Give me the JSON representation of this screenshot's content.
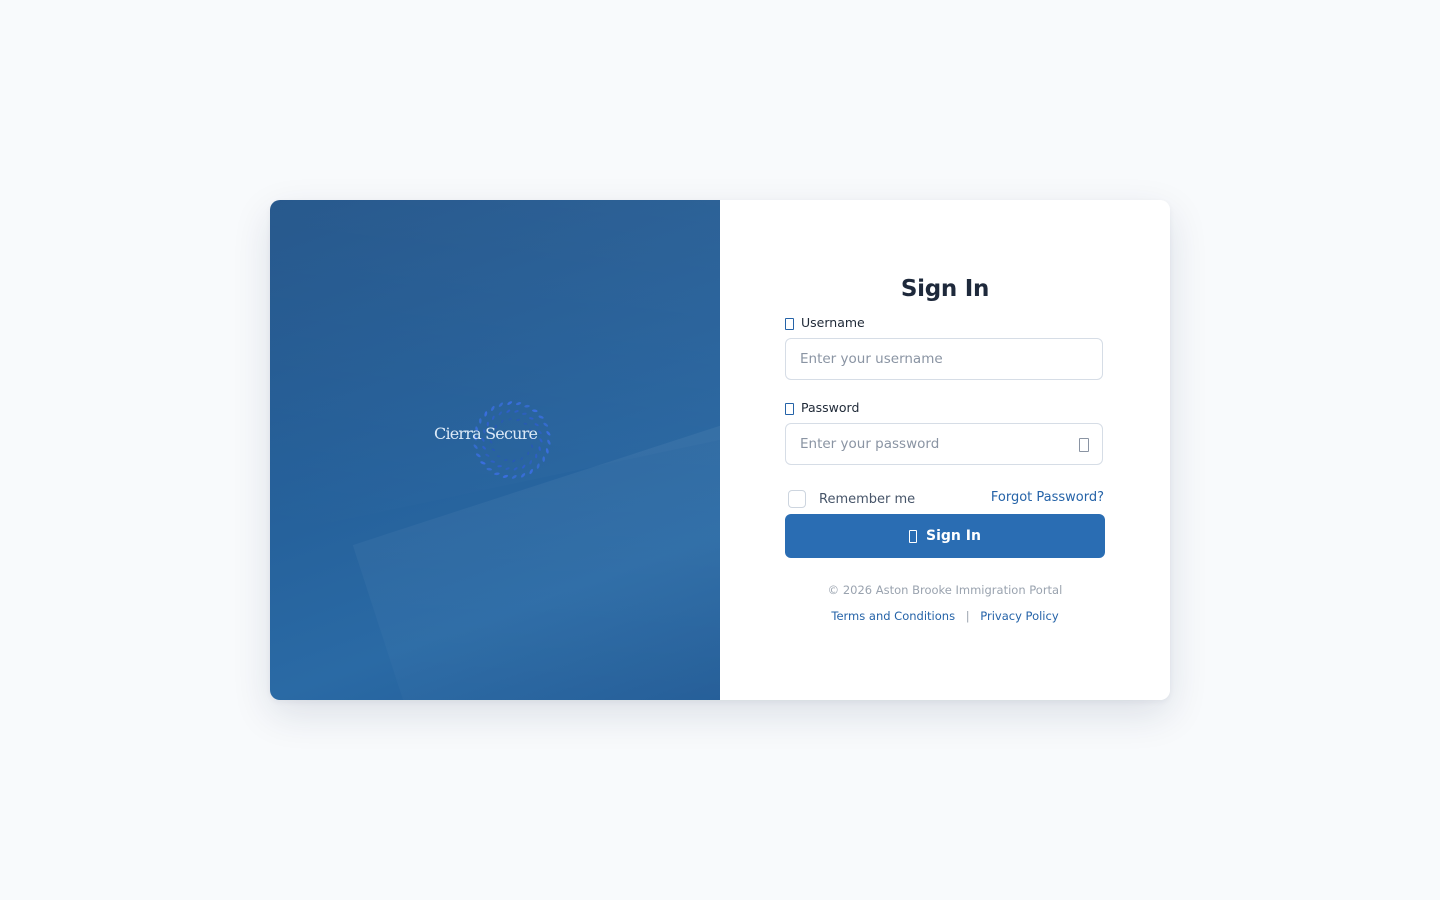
{
  "brand": {
    "logo_text": "Cierra Secure",
    "logo_icon": "dotted-circle-logo"
  },
  "form": {
    "title": "Sign In",
    "username": {
      "label": "Username",
      "icon": "user-icon",
      "placeholder": "Enter your username",
      "value": ""
    },
    "password": {
      "label": "Password",
      "icon": "lock-icon",
      "placeholder": "Enter your password",
      "value": "",
      "toggle_icon": "eye-icon"
    },
    "remember_label": "Remember me",
    "forgot_label": "Forgot Password?",
    "submit_label": "Sign In",
    "submit_icon": "sign-in-icon"
  },
  "footer": {
    "copyright": "© 2026 Aston Brooke Immigration Portal",
    "terms_label": "Terms and Conditions",
    "separator": "|",
    "privacy_label": "Privacy Policy"
  },
  "colors": {
    "background": "#f8fafc",
    "brand_panel": "#25609a",
    "accent": "#2a6db3",
    "link": "#2563a8"
  }
}
